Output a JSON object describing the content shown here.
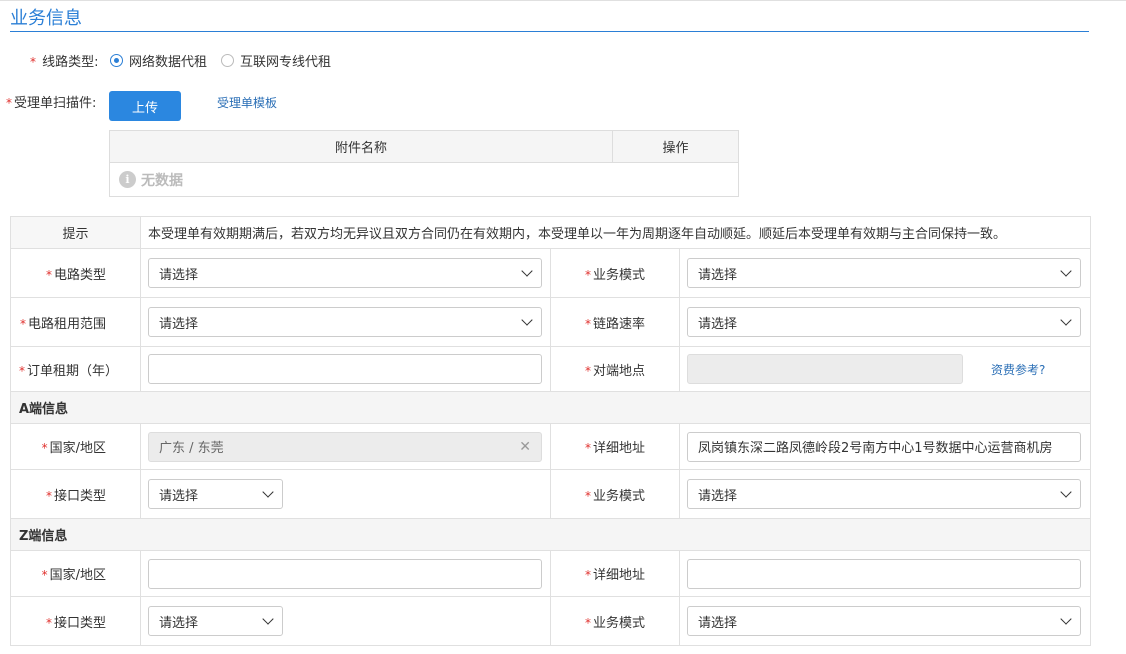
{
  "section_title": "业务信息",
  "line_type": {
    "label": "线路类型:",
    "options": [
      "网络数据代租",
      "互联网专线代租"
    ],
    "selected_index": 0
  },
  "scan": {
    "label": "受理单扫描件:",
    "upload_label": "上传",
    "template_link": "受理单模板"
  },
  "attachments": {
    "col_name": "附件名称",
    "col_op": "操作",
    "empty_text": "无数据"
  },
  "tip": {
    "label": "提示",
    "text": "本受理单有效期期满后，若双方均无异议且双方合同仍在有效期内，本受理单以一年为周期逐年自动顺延。顺延后本受理单有效期与主合同保持一致。"
  },
  "fields": {
    "circuit_type": {
      "label": "电路类型",
      "value": "请选择"
    },
    "biz_mode": {
      "label": "业务模式",
      "value": "请选择"
    },
    "circuit_scope": {
      "label": "电路租用范围",
      "value": "请选择"
    },
    "link_rate": {
      "label": "链路速率",
      "value": "请选择"
    },
    "order_term": {
      "label": "订单租期（年）",
      "value": ""
    },
    "peer_location": {
      "label": "对端地点",
      "value": ""
    },
    "fee_ref": "资费参考?"
  },
  "a_end": {
    "header": "A端信息",
    "country_label": "国家/地区",
    "country_value": "广东 / 东莞",
    "address_label": "详细地址",
    "address_value": "凤岗镇东深二路凤德岭段2号南方中心1号数据中心运营商机房",
    "iface_label": "接口类型",
    "iface_value": "请选择",
    "mode_label": "业务模式",
    "mode_value": "请选择"
  },
  "z_end": {
    "header": "Z端信息",
    "country_label": "国家/地区",
    "country_value": "",
    "address_label": "详细地址",
    "address_value": "",
    "iface_label": "接口类型",
    "iface_value": "请选择",
    "mode_label": "业务模式",
    "mode_value": "请选择"
  },
  "required_mark": "*",
  "colors": {
    "accent": "#2b7fd6",
    "required": "#e0302d"
  }
}
